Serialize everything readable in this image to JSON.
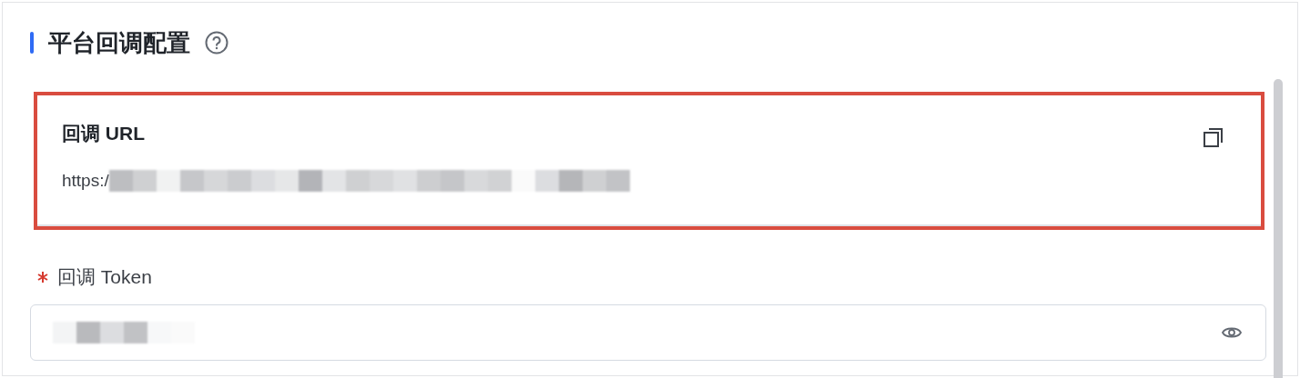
{
  "section": {
    "title": "平台回调配置"
  },
  "callback_url": {
    "label": "回调 URL",
    "value": "https:/",
    "redacted": true,
    "highlighted": true
  },
  "token_field": {
    "label": "回调 Token",
    "required": true,
    "redacted": true
  }
}
